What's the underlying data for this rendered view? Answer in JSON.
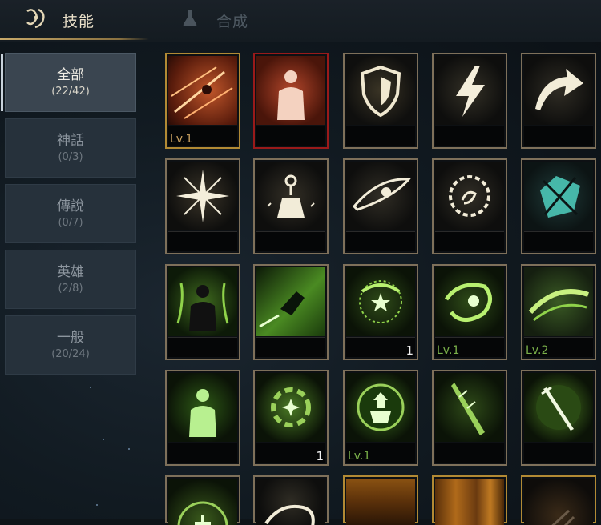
{
  "tabs": {
    "skills_label": "技能",
    "craft_label": "合成"
  },
  "categories": [
    {
      "name": "全部",
      "count": "(22/42)"
    },
    {
      "name": "神話",
      "count": "(0/3)"
    },
    {
      "name": "傳說",
      "count": "(0/7)"
    },
    {
      "name": "英雄",
      "count": "(2/8)"
    },
    {
      "name": "一般",
      "count": "(20/24)"
    }
  ],
  "slots": [
    {
      "icon": "orange-slash-icon",
      "label": "Lv.1",
      "badge": ""
    },
    {
      "icon": "orange-figure-icon",
      "label": "",
      "badge": ""
    },
    {
      "icon": "shield-icon",
      "label": "",
      "badge": ""
    },
    {
      "icon": "lightning-icon",
      "label": "",
      "badge": ""
    },
    {
      "icon": "curved-arrow-icon",
      "label": "",
      "badge": ""
    },
    {
      "icon": "burst-icon",
      "label": "",
      "badge": ""
    },
    {
      "icon": "pedestal-icon",
      "label": "",
      "badge": ""
    },
    {
      "icon": "eye-icon",
      "label": "",
      "badge": ""
    },
    {
      "icon": "spiked-ring-icon",
      "label": "",
      "badge": ""
    },
    {
      "icon": "teal-crystal-icon",
      "label": "",
      "badge": ""
    },
    {
      "icon": "green-aura-figure-icon",
      "label": "",
      "badge": ""
    },
    {
      "icon": "green-dash-icon",
      "label": "",
      "badge": ""
    },
    {
      "icon": "green-star-rune-icon",
      "label": "",
      "badge": "1"
    },
    {
      "icon": "green-swirl-icon",
      "label": "Lv.1",
      "badge": ""
    },
    {
      "icon": "green-slash-icon",
      "label": "Lv.2",
      "badge": ""
    },
    {
      "icon": "green-figure-icon",
      "label": "",
      "badge": ""
    },
    {
      "icon": "green-sparkle-icon",
      "label": "",
      "badge": "1"
    },
    {
      "icon": "green-emblem-icon",
      "label": "Lv.1",
      "badge": ""
    },
    {
      "icon": "green-blade-icon",
      "label": "",
      "badge": ""
    },
    {
      "icon": "green-sword-icon",
      "label": "",
      "badge": ""
    },
    {
      "icon": "green-rune-circle-icon",
      "label": "",
      "badge": ""
    },
    {
      "icon": "white-wave-icon",
      "label": "",
      "badge": ""
    },
    {
      "icon": "gold-glow-icon",
      "label": "",
      "badge": ""
    },
    {
      "icon": "gold-pillar-icon",
      "label": "",
      "badge": ""
    },
    {
      "icon": "gold-rune-icon",
      "label": "",
      "badge": ""
    }
  ]
}
